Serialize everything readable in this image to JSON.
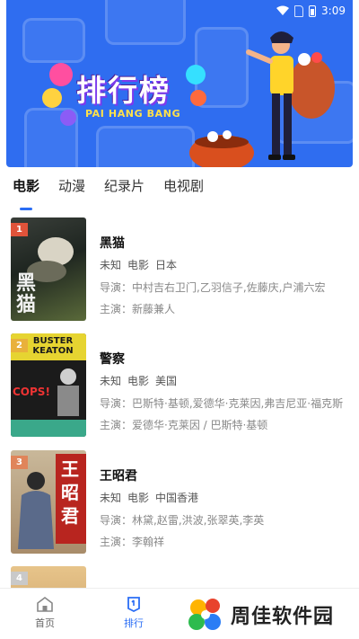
{
  "status_bar": {
    "time": "3:09"
  },
  "banner": {
    "title": "排行榜",
    "subtitle": "PAI HANG BANG"
  },
  "tabs": [
    {
      "label": "电影",
      "active": true
    },
    {
      "label": "动漫",
      "active": false
    },
    {
      "label": "纪录片",
      "active": false
    },
    {
      "label": "电视剧",
      "active": false
    }
  ],
  "items": [
    {
      "rank": "1",
      "rank_color": "#e0533a",
      "poster_text": "黑猫",
      "title": "黑猫",
      "tags": [
        "未知",
        "电影",
        "日本"
      ],
      "director": "导演：中村吉右卫门,乙羽信子,佐藤庆,户浦六宏",
      "cast": "主演：新藤兼人"
    },
    {
      "rank": "2",
      "rank_color": "#e9b13b",
      "poster_text": "BUSTER KEATON",
      "title": "警察",
      "tags": [
        "未知",
        "电影",
        "美国"
      ],
      "director": "导演：巴斯特·基顿,爱德华·克莱因,弗吉尼亚·福克斯",
      "cast": "主演：爱德华·克莱因 / 巴斯特·基顿"
    },
    {
      "rank": "3",
      "rank_color": "#e0855a",
      "poster_text": "王昭君",
      "title": "王昭君",
      "tags": [
        "未知",
        "电影",
        "中国香港"
      ],
      "director": "导演：林黛,赵雷,洪波,张翠英,李英",
      "cast": "主演：李翰祥"
    },
    {
      "rank": "4",
      "rank_color": "#c9c9c9",
      "poster_text": "",
      "title": "",
      "tags": [],
      "director": "",
      "cast": ""
    }
  ],
  "bottom_nav": [
    {
      "label": "首页",
      "icon": "home-icon",
      "active": false
    },
    {
      "label": "排行",
      "icon": "rank-icon",
      "active": true
    }
  ],
  "watermark": {
    "text": "周佳软件园"
  }
}
